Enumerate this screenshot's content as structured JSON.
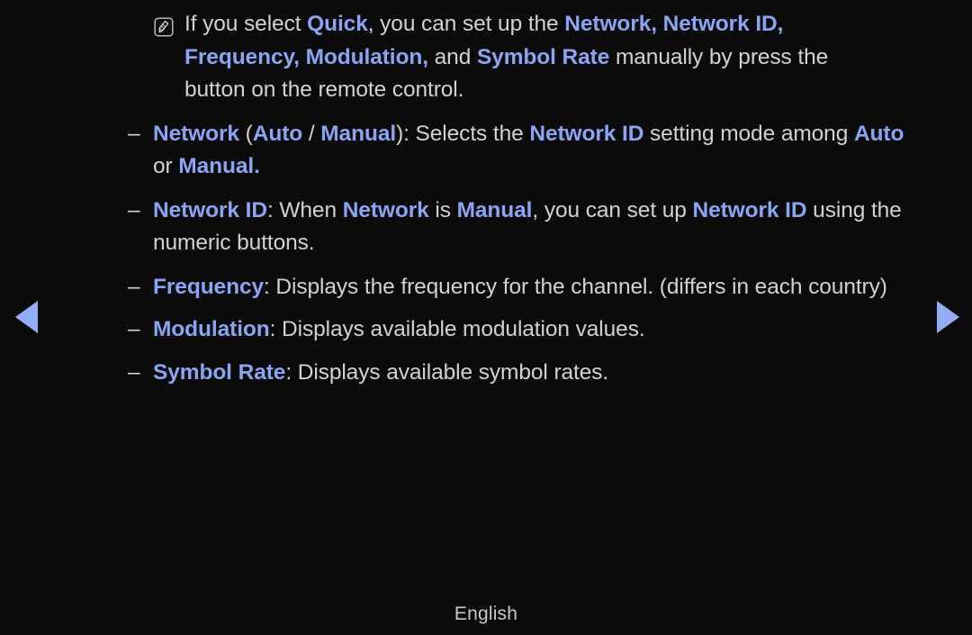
{
  "page": {
    "background_color": "#0a0b0a",
    "body_text_color": "#d2d2ce",
    "highlight_color": "#8ba5f2",
    "arrow_color": "#93adf7"
  },
  "note": {
    "icon": "note-pencil-icon",
    "segments": [
      {
        "text": "If you select ",
        "style": "plain"
      },
      {
        "text": "Quick",
        "style": "highlight"
      },
      {
        "text": ", you can set up the ",
        "style": "plain"
      },
      {
        "text": "Network, Network ID, Frequency, Modulation,",
        "style": "highlight"
      },
      {
        "text": " and ",
        "style": "plain"
      },
      {
        "text": "Symbol Rate",
        "style": "highlight"
      },
      {
        "text": " manually by press the button on the remote control.",
        "style": "plain"
      }
    ],
    "plain_text": "If you select Quick, you can set up the Network, Network ID, Frequency, Modulation, and Symbol Rate manually by press the button on the remote control."
  },
  "bullets": [
    {
      "dash": "–",
      "term": "Network",
      "plain_text": "Network (Auto / Manual): Selects the Network ID setting mode among Auto or Manual.",
      "segments": [
        {
          "text": "Network",
          "style": "highlight"
        },
        {
          "text": " (",
          "style": "plain"
        },
        {
          "text": "Auto",
          "style": "highlight"
        },
        {
          "text": " / ",
          "style": "plain"
        },
        {
          "text": "Manual",
          "style": "highlight"
        },
        {
          "text": "): Selects the ",
          "style": "plain"
        },
        {
          "text": "Network ID",
          "style": "highlight"
        },
        {
          "text": " setting mode among ",
          "style": "plain"
        },
        {
          "text": "Auto",
          "style": "highlight"
        },
        {
          "text": " or ",
          "style": "plain"
        },
        {
          "text": "Manual.",
          "style": "highlight"
        }
      ]
    },
    {
      "dash": "–",
      "term": "Network ID",
      "plain_text": "Network ID: When Network is Manual, you can set up Network ID using the numeric buttons.",
      "segments": [
        {
          "text": "Network ID",
          "style": "highlight"
        },
        {
          "text": ": When ",
          "style": "plain"
        },
        {
          "text": "Network",
          "style": "highlight"
        },
        {
          "text": " is ",
          "style": "plain"
        },
        {
          "text": "Manual",
          "style": "highlight"
        },
        {
          "text": ", you can set up ",
          "style": "plain"
        },
        {
          "text": "Network ID",
          "style": "highlight"
        },
        {
          "text": " using the numeric buttons.",
          "style": "plain"
        }
      ]
    },
    {
      "dash": "–",
      "term": "Frequency",
      "plain_text": "Frequency: Displays the frequency for the channel. (differs in each country)",
      "segments": [
        {
          "text": "Frequency",
          "style": "highlight"
        },
        {
          "text": ": Displays the frequency for the channel. (differs in each country)",
          "style": "plain"
        }
      ]
    },
    {
      "dash": "–",
      "term": "Modulation",
      "plain_text": "Modulation: Displays available modulation values.",
      "segments": [
        {
          "text": "Modulation",
          "style": "highlight"
        },
        {
          "text": ": Displays available modulation values.",
          "style": "plain"
        }
      ]
    },
    {
      "dash": "–",
      "term": "Symbol Rate",
      "plain_text": "Symbol Rate: Displays available symbol rates.",
      "segments": [
        {
          "text": "Symbol Rate",
          "style": "highlight"
        },
        {
          "text": ": Displays available symbol rates.",
          "style": "plain"
        }
      ]
    }
  ],
  "navigation": {
    "prev": {
      "icon": "triangle-left-icon",
      "label": ""
    },
    "next": {
      "icon": "triangle-right-icon",
      "label": ""
    }
  },
  "footer": {
    "language": "English"
  }
}
